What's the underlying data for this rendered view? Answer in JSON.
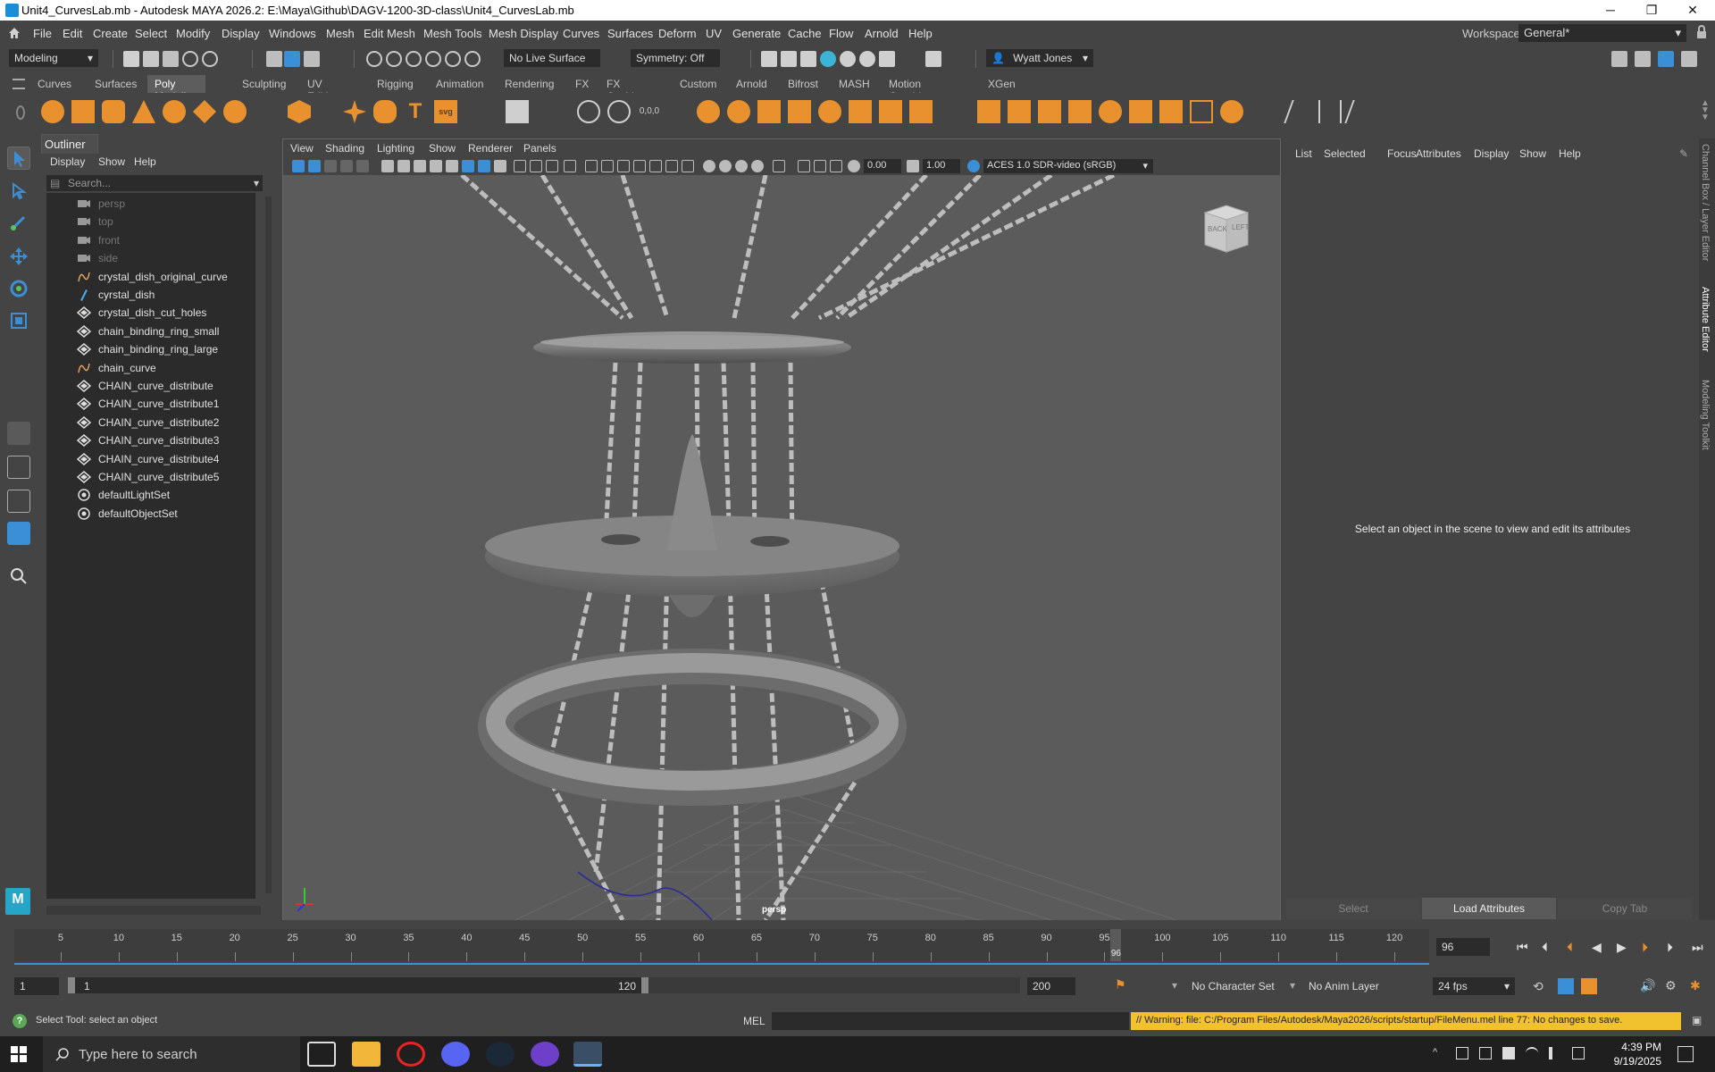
{
  "window": {
    "title": "Unit4_CurvesLab.mb - Autodesk MAYA 2026.2: E:\\Maya\\Github\\DAGV-1200-3D-class\\Unit4_CurvesLab.mb",
    "controls": {
      "minimize": "─",
      "maximize": "❐",
      "close": "✕"
    }
  },
  "menubar": {
    "items": [
      "File",
      "Edit",
      "Create",
      "Select",
      "Modify",
      "Display",
      "Windows",
      "Mesh",
      "Edit Mesh",
      "Mesh Tools",
      "Mesh Display",
      "Curves",
      "Surfaces",
      "Deform",
      "UV",
      "Generate",
      "Cache",
      "Flow",
      "Arnold",
      "Help"
    ],
    "workspace_label": "Workspace:",
    "workspace_value": "General*"
  },
  "statusline": {
    "mode": "Modeling",
    "live_surface": "No Live Surface",
    "symmetry": "Symmetry: Off",
    "user": "Wyatt Jones"
  },
  "shelf": {
    "tabs": [
      "Curves",
      "Surfaces",
      "Poly Modeling",
      "Sculpting",
      "UV Editing",
      "Rigging",
      "Animation",
      "Rendering",
      "FX",
      "FX Caching",
      "Custom",
      "Arnold",
      "Bifrost",
      "MASH",
      "Motion Graphics",
      "XGen"
    ],
    "active_tab": "Poly Modeling"
  },
  "outliner": {
    "title": "Outliner",
    "menu": [
      "Display",
      "Show",
      "Help"
    ],
    "search_placeholder": "Search...",
    "items": [
      {
        "label": "persp",
        "icon": "camera-icon",
        "dim": true
      },
      {
        "label": "top",
        "icon": "camera-icon",
        "dim": true
      },
      {
        "label": "front",
        "icon": "camera-icon",
        "dim": true
      },
      {
        "label": "side",
        "icon": "camera-icon",
        "dim": true
      },
      {
        "label": "crystal_dish_original_curve",
        "icon": "curve-icon",
        "dim": false
      },
      {
        "label": "cyrstal_dish",
        "icon": "nurbs-surface-icon",
        "dim": false
      },
      {
        "label": "crystal_dish_cut_holes",
        "icon": "mesh-icon",
        "dim": false
      },
      {
        "label": "chain_binding_ring_small",
        "icon": "mesh-icon",
        "dim": false
      },
      {
        "label": "chain_binding_ring_large",
        "icon": "mesh-icon",
        "dim": false
      },
      {
        "label": "chain_curve",
        "icon": "curve-icon",
        "dim": false
      },
      {
        "label": "CHAIN_curve_distribute",
        "icon": "mesh-icon",
        "dim": false
      },
      {
        "label": "CHAIN_curve_distribute1",
        "icon": "mesh-icon",
        "dim": false
      },
      {
        "label": "CHAIN_curve_distribute2",
        "icon": "mesh-icon",
        "dim": false
      },
      {
        "label": "CHAIN_curve_distribute3",
        "icon": "mesh-icon",
        "dim": false
      },
      {
        "label": "CHAIN_curve_distribute4",
        "icon": "mesh-icon",
        "dim": false
      },
      {
        "label": "CHAIN_curve_distribute5",
        "icon": "mesh-icon",
        "dim": false
      },
      {
        "label": "defaultLightSet",
        "icon": "set-icon",
        "dim": false
      },
      {
        "label": "defaultObjectSet",
        "icon": "set-icon",
        "dim": false
      }
    ]
  },
  "viewport": {
    "menu": [
      "View",
      "Shading",
      "Lighting",
      "Show",
      "Renderer",
      "Panels"
    ],
    "exposure": "0.00",
    "gamma": "1.00",
    "color_space": "ACES 1.0 SDR-video (sRGB)",
    "camera_label": "persp",
    "viewcube_faces": [
      "BACK",
      "LEFT"
    ]
  },
  "attribute_editor": {
    "menu": [
      "List",
      "Selected",
      "Focus",
      "Attributes",
      "Display",
      "Show",
      "Help"
    ],
    "message": "Select an object in the scene to view and edit its attributes",
    "buttons": [
      "Select",
      "Load Attributes",
      "Copy Tab"
    ],
    "side_tabs": [
      "Channel Box / Layer Editor",
      "Attribute Editor",
      "Modeling Toolkit"
    ]
  },
  "timeline": {
    "ticks": [
      "5",
      "10",
      "15",
      "20",
      "25",
      "30",
      "35",
      "40",
      "45",
      "50",
      "55",
      "60",
      "65",
      "70",
      "75",
      "80",
      "85",
      "90",
      "95",
      "100",
      "105",
      "110",
      "115",
      "120"
    ],
    "current_frame": "96",
    "current_frame_field": "96"
  },
  "range": {
    "start": "1",
    "playback_start": "1",
    "playback_end": "120",
    "end": "200",
    "character_set": "No Character Set",
    "anim_layer": "No Anim Layer",
    "fps": "24 fps"
  },
  "commandline": {
    "help_line": "Select Tool: select an object",
    "language": "MEL",
    "warning": "// Warning: file: C:/Program Files/Autodesk/Maya2026/scripts/startup/FileMenu.mel line 77: No changes to save."
  },
  "taskbar": {
    "search_placeholder": "Type here to search",
    "time": "4:39 PM",
    "date": "9/19/2025"
  }
}
